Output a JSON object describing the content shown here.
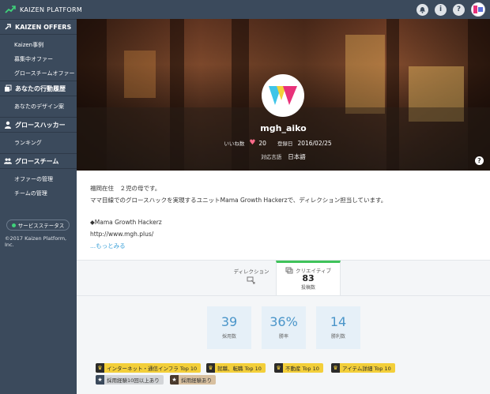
{
  "brand": {
    "name": "KAIZEN PLATFORM"
  },
  "sidebar": {
    "sections": [
      {
        "title": "KAIZEN OFFERS",
        "icon": "kaizen-arrow-icon",
        "items": [
          "Kaizen事例",
          "募集中オファー",
          "グロースチームオファー"
        ]
      },
      {
        "title": "あなたの行動履歴",
        "icon": "history-icon",
        "items": [
          "あなたのデザイン案"
        ]
      },
      {
        "title": "グロースハッカー",
        "icon": "user-icon",
        "items": [
          "ランキング"
        ]
      },
      {
        "title": "グロースチーム",
        "icon": "team-icon",
        "items": [
          "オファーの管理",
          "チームの管理"
        ]
      }
    ],
    "service_status": "サービスステータス",
    "copyright": "©2017 Kaizen Platform, Inc."
  },
  "profile": {
    "username": "mgh_aiko",
    "likes_label": "いいね数",
    "likes": "20",
    "registered_label": "登録日",
    "registered": "2016/02/25",
    "language_label": "対応言語",
    "language": "日本語"
  },
  "bio": {
    "line1": "福岡在住　２児の母です。",
    "line2": "ママ目線でのグロースハックを実現するユニットMama Growth Hackerzで、ディレクション担当しています。",
    "line3": "◆Mama Growth Hackerz",
    "line4": "http://www.mgh.plus/",
    "more": "...もっとみる"
  },
  "tabs": {
    "direction": "ディレクション",
    "creative": "クリエイティブ",
    "creative_count": "83",
    "creative_sub": "投稿数"
  },
  "stats": [
    {
      "value": "39",
      "label": "採用数"
    },
    {
      "value": "36%",
      "label": "勝率"
    },
    {
      "value": "14",
      "label": "勝利数"
    }
  ],
  "badges": [
    "インターネット・通信インフラ Top 10",
    "就職、転職 Top 10",
    "不動産 Top 10",
    "アイテム詳細 Top 10",
    "採用経験10回以上あり",
    "採用経験あり"
  ],
  "colors": {
    "sidebar": "#3b4a5c",
    "accent_green": "#3fc35a",
    "stat_blue": "#4a95c9",
    "badge_gold": "#f3cf3a"
  }
}
